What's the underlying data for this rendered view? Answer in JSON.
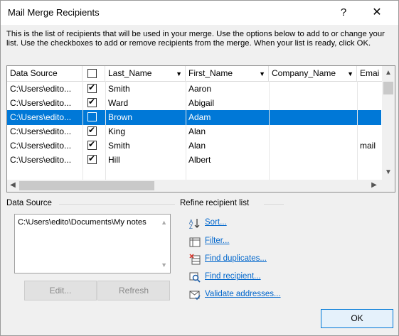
{
  "window": {
    "title": "Mail Merge Recipients",
    "help": "?",
    "close": "✕"
  },
  "description": "This is the list of recipients that will be used in your merge.  Use the options below to add to or change your list.  Use the checkboxes to add or remove recipients from the merge.  When your list is ready, click OK.",
  "table": {
    "columns": [
      "Data Source",
      "",
      "Last_Name",
      "First_Name",
      "Company_Name",
      "Emai"
    ],
    "rows": [
      {
        "source": "C:\\Users\\edito...",
        "checked": true,
        "last": "Smith",
        "first": "Aaron",
        "company": "",
        "email": ""
      },
      {
        "source": "C:\\Users\\edito...",
        "checked": true,
        "last": "Ward",
        "first": "Abigail",
        "company": "",
        "email": ""
      },
      {
        "source": "C:\\Users\\edito...",
        "checked": false,
        "last": "Brown",
        "first": "Adam",
        "company": "",
        "email": "",
        "selected": true
      },
      {
        "source": "C:\\Users\\edito...",
        "checked": true,
        "last": "King",
        "first": "Alan",
        "company": "",
        "email": ""
      },
      {
        "source": "C:\\Users\\edito...",
        "checked": true,
        "last": "Smith",
        "first": "Alan",
        "company": "",
        "email": "mail"
      },
      {
        "source": "C:\\Users\\edito...",
        "checked": true,
        "last": "Hill",
        "first": "Albert",
        "company": "",
        "email": ""
      }
    ]
  },
  "data_source": {
    "label": "Data Source",
    "item": "C:\\Users\\edito\\Documents\\My notes",
    "edit_label": "Edit...",
    "refresh_label": "Refresh"
  },
  "refine": {
    "label": "Refine recipient list",
    "sort": "Sort...",
    "filter": "Filter...",
    "find_duplicates": "Find duplicates...",
    "find_recipient": "Find recipient...",
    "validate": "Validate addresses..."
  },
  "ok_label": "OK",
  "colors": {
    "selection": "#0078d7",
    "link": "#0066cc",
    "dialog_bg": "#f0f0f0"
  }
}
